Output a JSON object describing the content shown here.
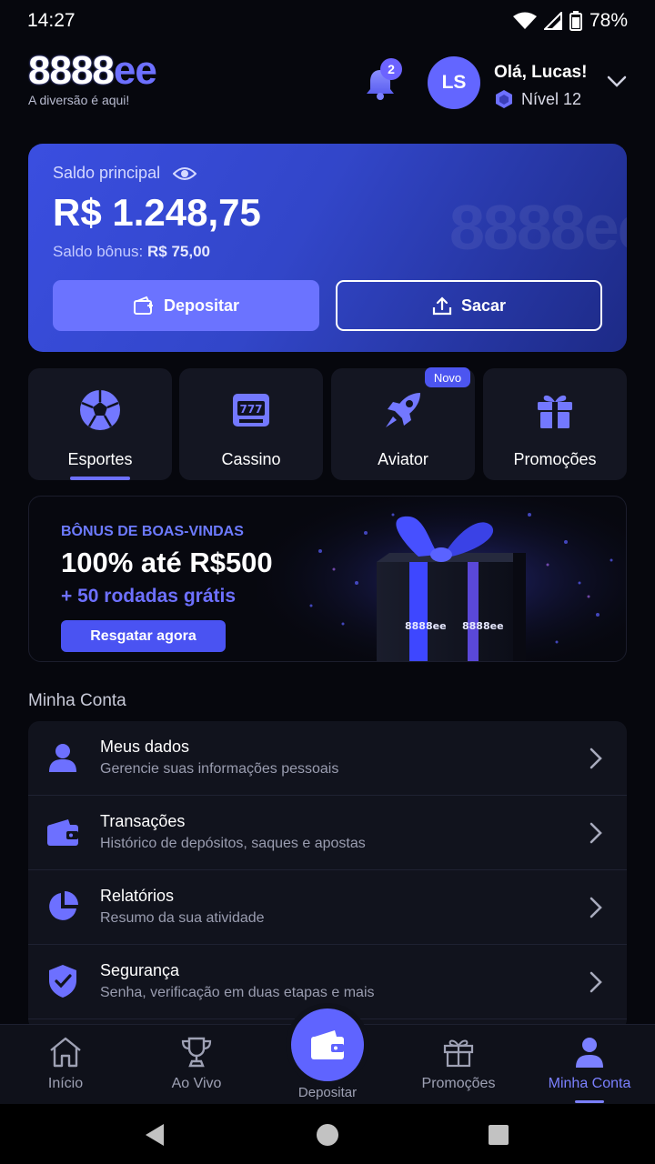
{
  "status": {
    "time": "14:27",
    "battery": "78%"
  },
  "header": {
    "logo_white": "8888",
    "logo_accent": "ee",
    "tagline": "A diversão é aqui!",
    "notifications": "2",
    "avatar_initials": "LS",
    "greeting": "Olá, Lucas!",
    "level": "Nível 12"
  },
  "balance": {
    "label": "Saldo principal",
    "amount": "R$ 1.248,75",
    "bonus_label": "Saldo bônus:",
    "bonus_value": "R$ 75,00",
    "deposit": "Depositar",
    "withdraw": "Sacar",
    "watermark": "8888ee"
  },
  "tiles": [
    {
      "label": "Esportes",
      "icon": "soccer-ball-icon"
    },
    {
      "label": "Cassino",
      "icon": "slot-machine-icon"
    },
    {
      "label": "Aviator",
      "icon": "rocket-icon"
    },
    {
      "label": "Promoções",
      "icon": "gift-icon"
    }
  ],
  "tile_badge": "Novo",
  "promo": {
    "kicker": "BÔNUS DE BOAS-VINDAS",
    "title": "100% até R$500",
    "subtitle": "+ 50 rodadas grátis",
    "button": "Resgatar agora",
    "box_logo": "8888ee"
  },
  "account": {
    "title": "Minha Conta",
    "items": [
      {
        "title": "Meus dados",
        "subtitle": "Gerencie suas informações pessoais",
        "icon": "user-icon"
      },
      {
        "title": "Transações",
        "subtitle": "Histórico de depósitos, saques e apostas",
        "icon": "wallet-icon"
      },
      {
        "title": "Relatórios",
        "subtitle": "Resumo da sua atividade",
        "icon": "pie-chart-icon"
      },
      {
        "title": "Segurança",
        "subtitle": "Senha, verificação em duas etapas e mais",
        "icon": "shield-icon"
      }
    ]
  },
  "bottom_nav": {
    "home": "Início",
    "live": "Ao Vivo",
    "deposit": "Depositar",
    "promos": "Promoções",
    "account": "Minha Conta"
  },
  "colors": {
    "accent": "#6d70ff",
    "background": "#06070d",
    "card": "#141622"
  }
}
